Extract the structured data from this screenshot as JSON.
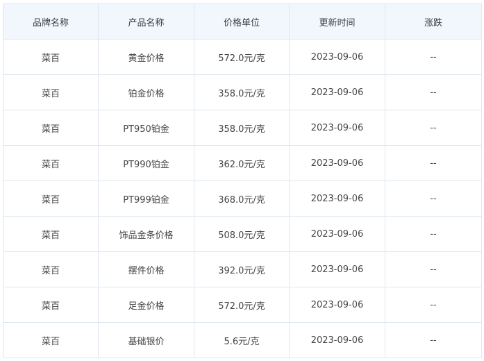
{
  "table": {
    "headers": [
      "品牌名称",
      "产品名称",
      "价格单位",
      "更新时间",
      "涨跌"
    ],
    "rows": [
      [
        "菜百",
        "黄金价格",
        "572.0元/克",
        "2023-09-06",
        "--"
      ],
      [
        "菜百",
        "铂金价格",
        "358.0元/克",
        "2023-09-06",
        "--"
      ],
      [
        "菜百",
        "PT950铂金",
        "358.0元/克",
        "2023-09-06",
        "--"
      ],
      [
        "菜百",
        "PT990铂金",
        "362.0元/克",
        "2023-09-06",
        "--"
      ],
      [
        "菜百",
        "PT999铂金",
        "368.0元/克",
        "2023-09-06",
        "--"
      ],
      [
        "菜百",
        "饰品金条价格",
        "508.0元/克",
        "2023-09-06",
        "--"
      ],
      [
        "菜百",
        "摆件价格",
        "392.0元/克",
        "2023-09-06",
        "--"
      ],
      [
        "菜百",
        "足金价格",
        "572.0元/克",
        "2023-09-06",
        "--"
      ],
      [
        "菜百",
        "基础银价",
        "5.6元/克",
        "2023-09-06",
        "--"
      ]
    ]
  }
}
